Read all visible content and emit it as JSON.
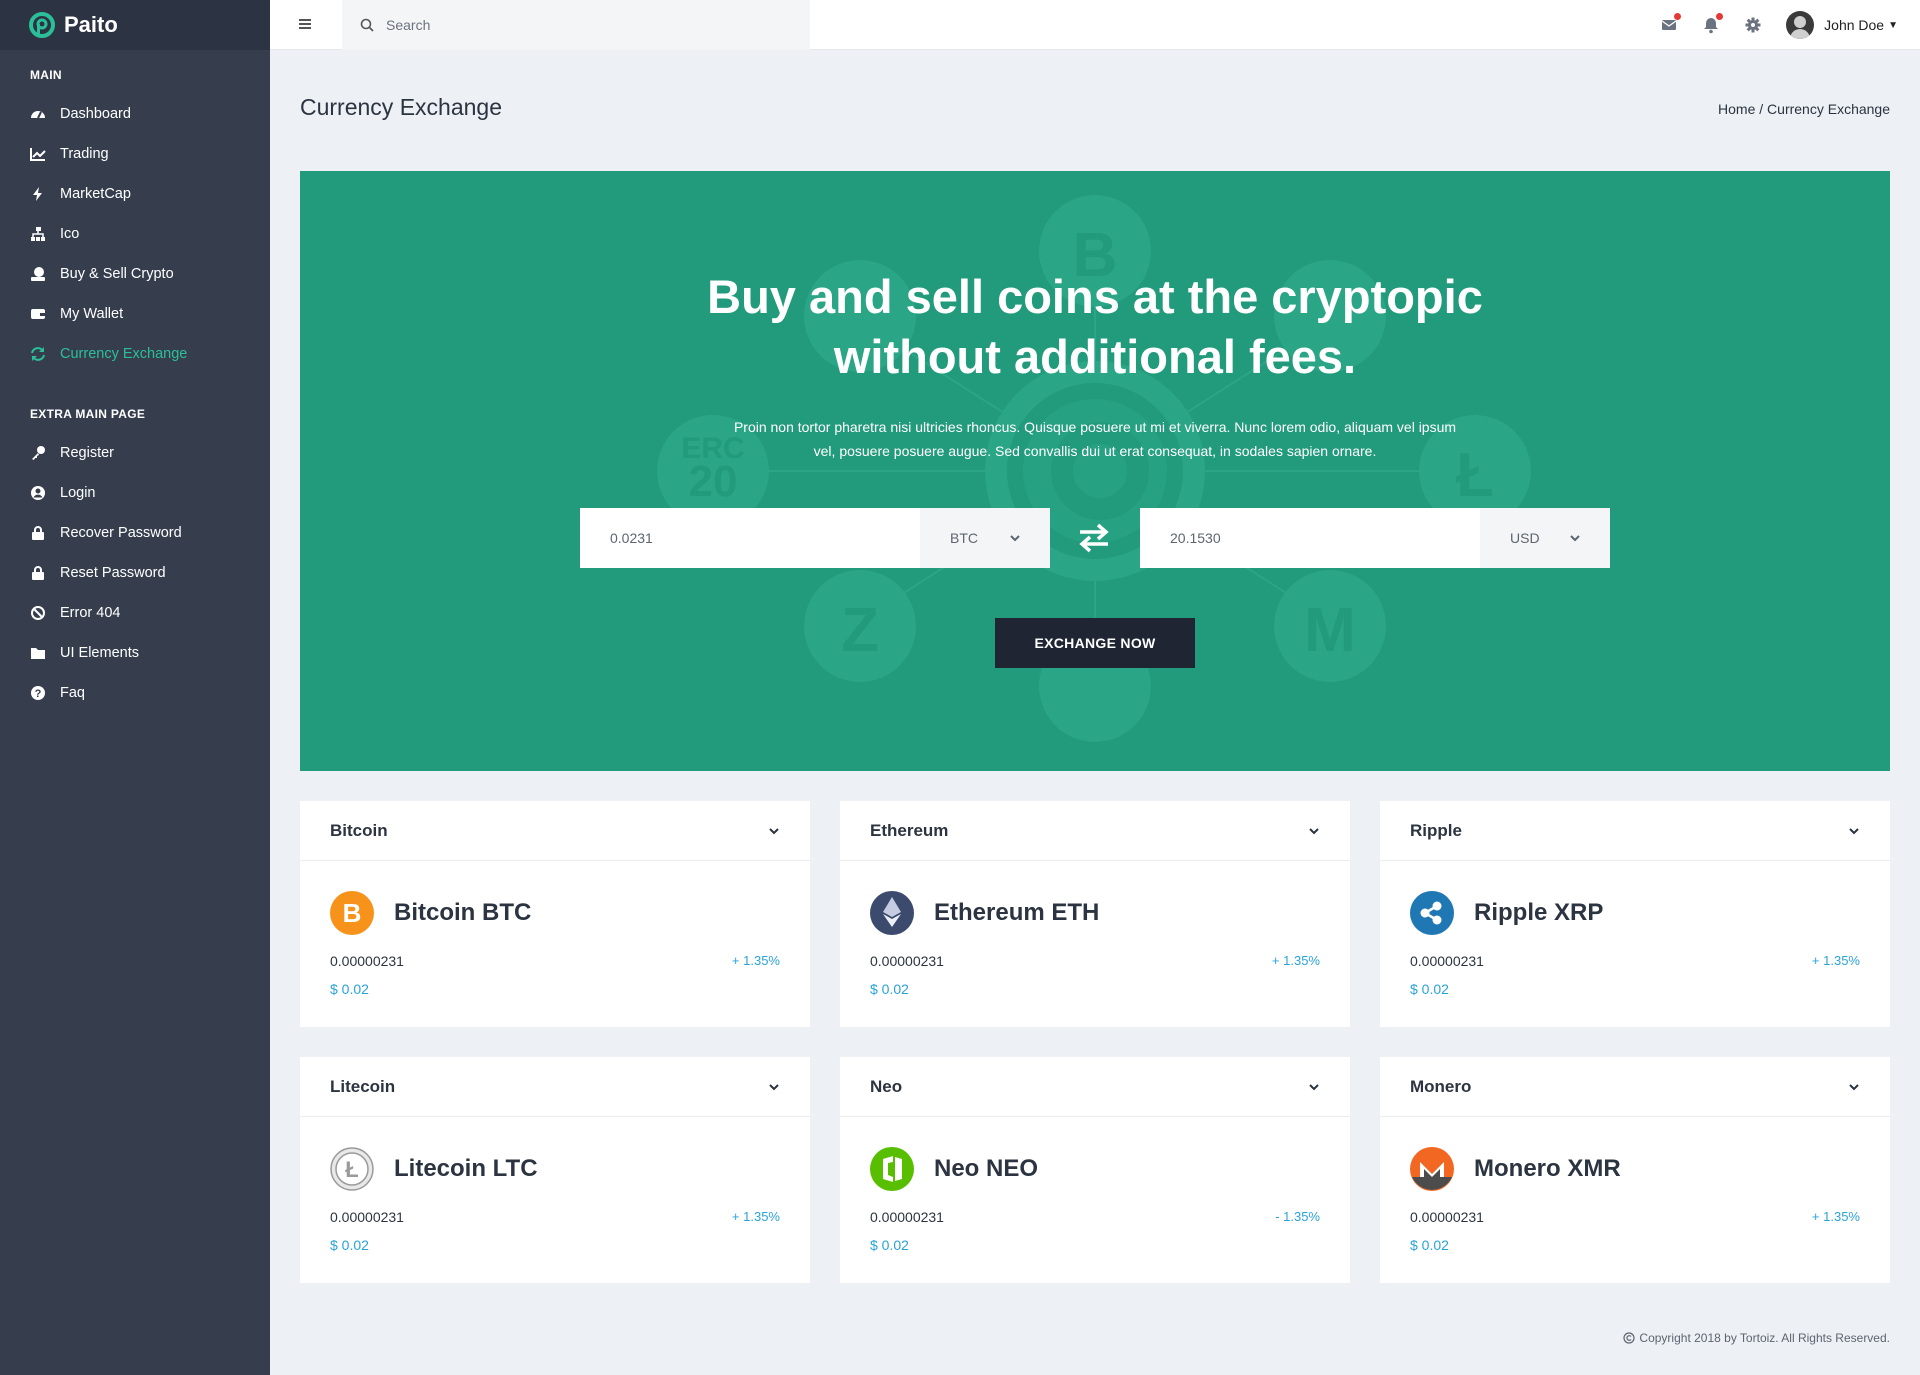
{
  "brand": {
    "name": "Paito"
  },
  "sidebar": {
    "main_title": "MAIN",
    "main_items": [
      {
        "label": "Dashboard",
        "icon": "dashboard-icon"
      },
      {
        "label": "Trading",
        "icon": "chart-icon"
      },
      {
        "label": "MarketCap",
        "icon": "bolt-icon"
      },
      {
        "label": "Ico",
        "icon": "sitemap-icon"
      },
      {
        "label": "Buy & Sell Crypto",
        "icon": "coins-icon"
      },
      {
        "label": "My Wallet",
        "icon": "wallet-icon"
      },
      {
        "label": "Currency Exchange",
        "icon": "refresh-icon",
        "active": true
      }
    ],
    "extra_title": "EXTRA MAIN PAGE",
    "extra_items": [
      {
        "label": "Register",
        "icon": "key-icon"
      },
      {
        "label": "Login",
        "icon": "user-circle-icon"
      },
      {
        "label": "Recover Password",
        "icon": "lock-icon"
      },
      {
        "label": "Reset Password",
        "icon": "lock-icon"
      },
      {
        "label": "Error 404",
        "icon": "ban-icon"
      },
      {
        "label": "UI Elements",
        "icon": "folder-icon"
      },
      {
        "label": "Faq",
        "icon": "question-icon"
      }
    ],
    "active_color": "#2bbf99"
  },
  "topbar": {
    "search_placeholder": "Search",
    "user_name": "John Doe"
  },
  "page": {
    "title": "Currency Exchange",
    "breadcrumb": "Home / Currency Exchange"
  },
  "hero": {
    "title_line1": "Buy and sell coins at the cryptopic",
    "title_line2": "without additional fees.",
    "text_line1": "Proin non tortor pharetra nisi ultricies rhoncus. Quisque posuere ut mi et viverra. Nunc lorem odio, aliquam vel ipsum",
    "text_line2": "vel, posuere posuere augue. Sed convallis dui ut erat consequat, in sodales sapien ornare.",
    "from_value": "0.0231",
    "from_currency": "BTC",
    "to_value": "20.1530",
    "to_currency": "USD",
    "button_label": "EXCHANGE NOW",
    "bg_color": "#229a7c"
  },
  "cards": [
    {
      "header": "Bitcoin",
      "name": "Bitcoin BTC",
      "amount": "0.00000231",
      "change": "+ 1.35%",
      "price": "$ 0.02",
      "icon": "bitcoin-icon"
    },
    {
      "header": "Ethereum",
      "name": "Ethereum ETH",
      "amount": "0.00000231",
      "change": "+ 1.35%",
      "price": "$ 0.02",
      "icon": "ethereum-icon"
    },
    {
      "header": "Ripple",
      "name": "Ripple XRP",
      "amount": "0.00000231",
      "change": "+ 1.35%",
      "price": "$ 0.02",
      "icon": "ripple-icon"
    },
    {
      "header": "Litecoin",
      "name": "Litecoin LTC",
      "amount": "0.00000231",
      "change": "+ 1.35%",
      "price": "$ 0.02",
      "icon": "litecoin-icon"
    },
    {
      "header": "Neo",
      "name": "Neo NEO",
      "amount": "0.00000231",
      "change": "- 1.35%",
      "price": "$ 0.02",
      "icon": "neo-icon"
    },
    {
      "header": "Monero",
      "name": "Monero XMR",
      "amount": "0.00000231",
      "change": "+ 1.35%",
      "price": "$ 0.02",
      "icon": "monero-icon"
    }
  ],
  "footer": {
    "text": "Copyright 2018 by Tortoiz. All Rights Reserved."
  }
}
